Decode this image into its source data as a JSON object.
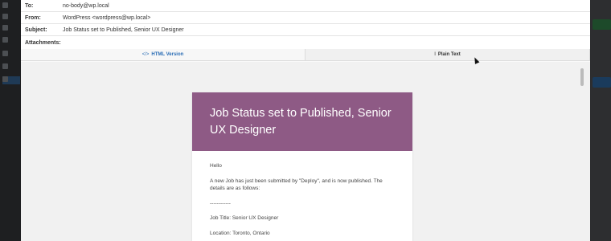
{
  "email": {
    "to_label": "To:",
    "to_value": "no-body@wp.local",
    "from_label": "From:",
    "from_value": "WordPress <wordpress@wp.local>",
    "subject_label": "Subject:",
    "subject_value": "Job Status set to Published, Senior UX Designer",
    "attachments_label": "Attachments:"
  },
  "tabs": {
    "html_icon": "</>",
    "html_label": "HTML Version",
    "plain_icon": "I",
    "plain_label": "Plain Text"
  },
  "preview": {
    "heading": "Job Status set to Published, Senior UX Designer",
    "greeting": "Hello",
    "intro": "A new Job has just been submitted by \"Deploy\", and is now published. The details are as follows:",
    "divider": "------------",
    "job_title": "Job Title: Senior UX Designer",
    "location": "Location: Toronto, Ontario"
  },
  "colors": {
    "header_bg": "#8e5a85",
    "tab_link": "#2a6db5"
  }
}
